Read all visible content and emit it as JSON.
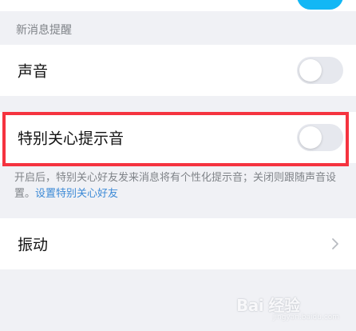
{
  "section": {
    "title": "新消息提醒"
  },
  "rows": {
    "sound": {
      "label": "声音",
      "toggle_on": false
    },
    "special_care_tone": {
      "label": "特别关心提示音",
      "toggle_on": false
    },
    "vibration": {
      "label": "振动"
    }
  },
  "description": {
    "text": "开启后，特别关心好友发来消息将有个性化提示音；关闭则跟随声音设置。",
    "link": "设置特别关心好友"
  },
  "watermark": {
    "logo_text": "Bai 经验",
    "url": "jingyan.baidu.com"
  },
  "colors": {
    "accent": "#12b7f5",
    "highlight": "#f5333f",
    "link": "#3d8ad6",
    "toggle_off": "#e6e8ee"
  }
}
